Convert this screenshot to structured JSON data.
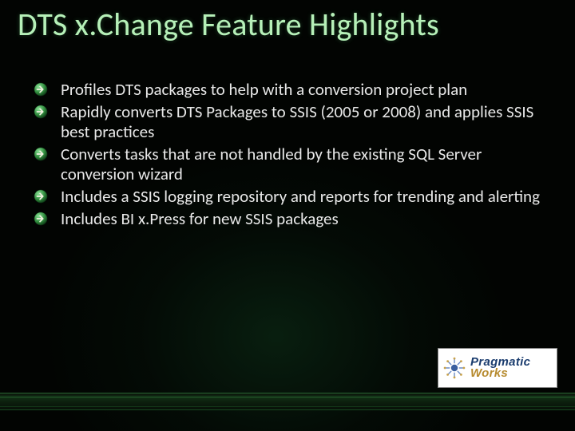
{
  "title": "DTS x.Change Feature Highlights",
  "bullets": [
    "Profiles DTS packages to help with a conversion project plan",
    "Rapidly converts DTS Packages to SSIS (2005 or 2008) and applies SSIS best practices",
    "Converts tasks that are not handled by the existing SQL Server conversion wizard",
    "Includes a SSIS logging repository and reports for trending and alerting",
    "Includes BI x.Press for new SSIS packages"
  ],
  "logo": {
    "line1": "Pragmatic",
    "line2": "Works"
  }
}
